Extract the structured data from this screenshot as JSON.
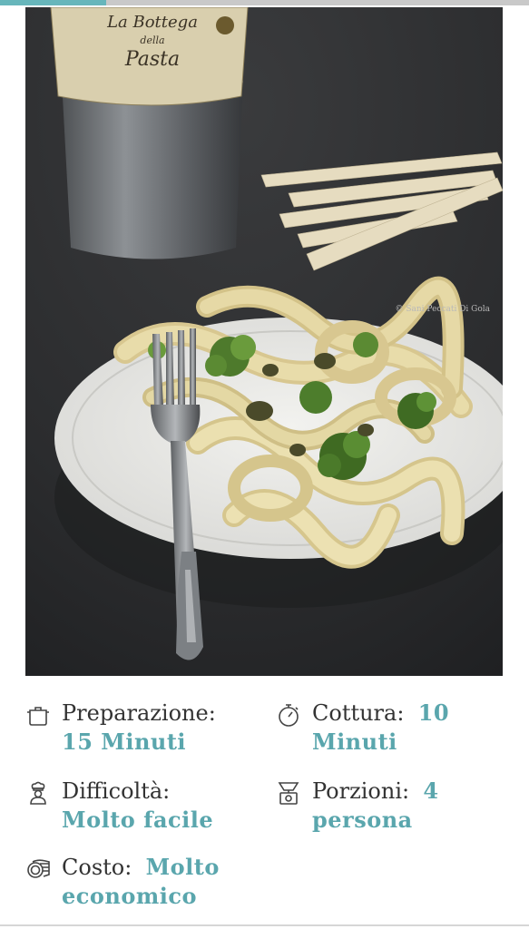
{
  "reading_progress": 0.2,
  "photo": {
    "alt": "Piatto di pappardelle con broccoli e capperi",
    "package_label_line1": "La Bottega",
    "package_label_line2": "della",
    "package_label_line3": "Pasta",
    "watermark": "© Sani Peccati Di Gola"
  },
  "recipe_info": {
    "prep": {
      "label": "Preparazione:",
      "value_line1": "15 Minuti"
    },
    "cook": {
      "label": "Cottura:",
      "value_inline": "10",
      "value_line2": "Minuti"
    },
    "difficulty": {
      "label": "Difficoltà:",
      "value_line1": "Molto facile"
    },
    "servings": {
      "label": "Porzioni:",
      "value_inline": "4",
      "value_line2": "persona"
    },
    "cost": {
      "label": "Costo:",
      "value_inline": "Molto",
      "value_line2": "economico"
    }
  },
  "colors": {
    "accent": "#5aa6ad",
    "label_text": "#333333",
    "progress_fill": "#67b6bb",
    "progress_track": "#c9c9c9"
  },
  "icons": {
    "prep": "cooking-pot-icon",
    "cook": "stopwatch-icon",
    "difficulty": "chef-icon",
    "servings": "kitchen-scale-icon",
    "cost": "coins-icon"
  }
}
